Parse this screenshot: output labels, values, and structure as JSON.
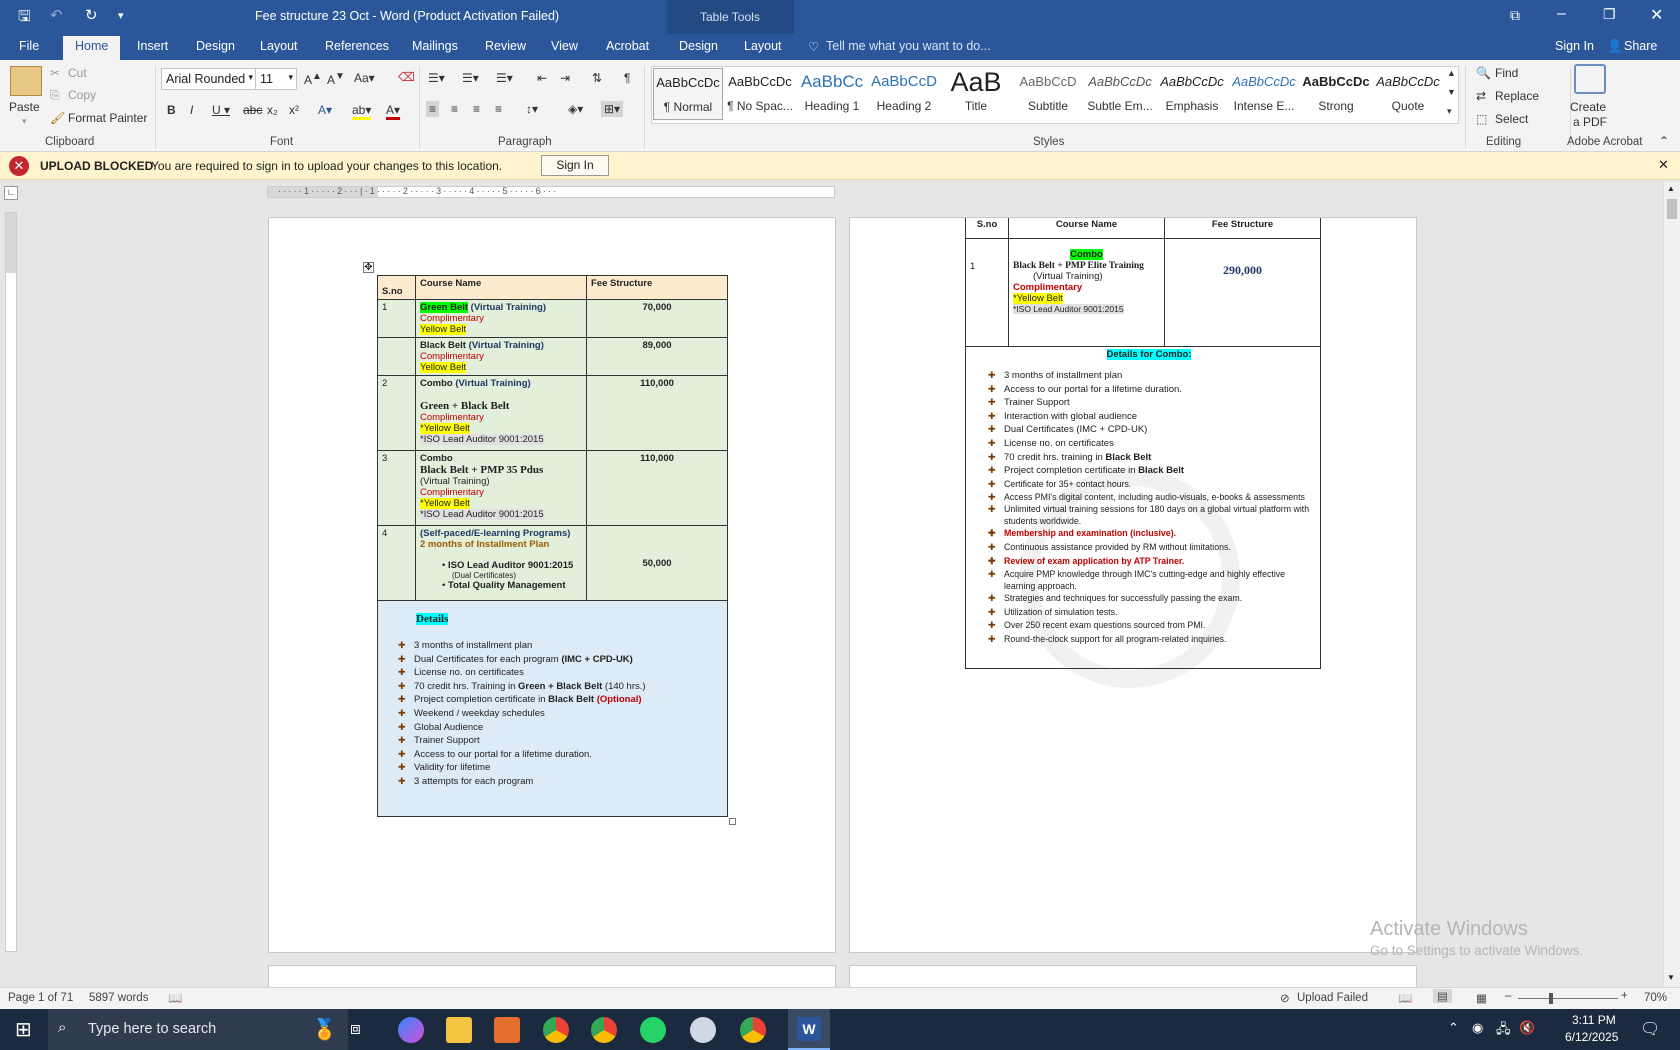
{
  "window": {
    "title": "Fee structure 23 Oct - Word (Product Activation Failed)",
    "context_tab": "Table Tools",
    "tell_me": "Tell me what you want to do...",
    "sign_in": "Sign In",
    "share": "Share"
  },
  "tabs": [
    "File",
    "Home",
    "Insert",
    "Design",
    "Layout",
    "References",
    "Mailings",
    "Review",
    "View",
    "Acrobat",
    "Design",
    "Layout"
  ],
  "ribbon": {
    "clipboard": {
      "paste": "Paste",
      "cut": "Cut",
      "copy": "Copy",
      "format_painter": "Format Painter",
      "label": "Clipboard"
    },
    "font": {
      "name": "Arial Rounded",
      "size": "11",
      "label": "Font"
    },
    "paragraph": {
      "label": "Paragraph"
    },
    "styles": {
      "label": "Styles",
      "items": [
        {
          "preview": "AaBbCcDc",
          "name": "¶ Normal"
        },
        {
          "preview": "AaBbCcDc",
          "name": "¶ No Spac..."
        },
        {
          "preview": "AaBbCc",
          "name": "Heading 1"
        },
        {
          "preview": "AaBbCcD",
          "name": "Heading 2"
        },
        {
          "preview": "AaB",
          "name": "Title"
        },
        {
          "preview": "AaBbCcD",
          "name": "Subtitle"
        },
        {
          "preview": "AaBbCcDc",
          "name": "Subtle Em..."
        },
        {
          "preview": "AaBbCcDc",
          "name": "Emphasis"
        },
        {
          "preview": "AaBbCcDc",
          "name": "Intense E..."
        },
        {
          "preview": "AaBbCcDc",
          "name": "Strong"
        },
        {
          "preview": "AaBbCcDc",
          "name": "Quote"
        }
      ]
    },
    "editing": {
      "find": "Find",
      "replace": "Replace",
      "select": "Select",
      "label": "Editing"
    },
    "acrobat": {
      "create1": "Create",
      "create2": "a PDF",
      "label": "Adobe Acrobat"
    }
  },
  "message": {
    "title": "UPLOAD BLOCKED",
    "text": "You are required to sign in to upload your changes to this location.",
    "button": "Sign In"
  },
  "page1": {
    "headers": {
      "sno": "S.no",
      "course": "Course Name",
      "fee": "Fee Structure"
    },
    "r1": {
      "sno": "1",
      "green": "Green Belt",
      "vt": " (Virtual Training)",
      "comp": "Complimentary",
      "yb": "Yellow Belt",
      "fee": "70,000"
    },
    "r1b": {
      "bb": "Black Belt",
      "vt": " (Virtual Training)",
      "comp": "Complimentary",
      "yb": "Yellow Belt",
      "fee": "89,000"
    },
    "r2": {
      "sno": "2",
      "combo": "Combo",
      "vt": " (Virtual Training)",
      "gb": "Green + Black Belt",
      "comp": "Complimentary",
      "yb": "*Yellow Belt",
      "iso": "*ISO Lead Auditor 9001:2015",
      "fee": "110,000"
    },
    "r3": {
      "sno": "3",
      "combo": "Combo",
      "bp": "Black Belt + PMP 35 Pdus",
      "vt": "(Virtual Training)",
      "comp": "Complimentary",
      "yb": "*Yellow Belt",
      "iso": "*ISO Lead Auditor 9001:2015",
      "fee": "110,000"
    },
    "r4": {
      "sno": "4",
      "sp": "(Self-paced/E-learning Programs)",
      "inst": "2 months of Installment Plan",
      "b1": "ISO Lead Auditor 9001:2015",
      "b1s": "(Dual Certificates)",
      "b2": "Total Quality Management",
      "fee": "50,000"
    },
    "details_title": "Details",
    "details": {
      "d1": "3 months of installment plan",
      "d2a": "Dual Certificates for each program ",
      "d2b": "(IMC + CPD-UK)",
      "d3": "License no. on certificates",
      "d4a": "70 credit hrs. Training in ",
      "d4b": "Green + Black Belt",
      "d4c": " (140 hrs.)",
      "d5a": "Project completion certificate in ",
      "d5b": "Black Belt",
      "d5c": " (Optional)",
      "d6": "Weekend / weekday schedules",
      "d7": "Global Audience",
      "d8": "Trainer Support",
      "d9": "Access to our portal for a lifetime duration.",
      "d10": "Validity for lifetime",
      "d11": "3 attempts for each program"
    }
  },
  "page2": {
    "headers": {
      "sno": "S.no",
      "course": "Course Name",
      "fee": "Fee Structure"
    },
    "row": {
      "sno": "1",
      "combo": "Combo",
      "bp": "Black Belt + PMP Elite Training",
      "vt": "(Virtual Training)",
      "comp": "Complimentary",
      "yb": "*Yellow Belt",
      "iso": "*ISO Lead Auditor 9001:2015",
      "fee": "290,000"
    },
    "details_title": "Details for Combo:",
    "items": {
      "i1": "3 months of installment plan",
      "i2": "Access to our portal for a lifetime duration.",
      "i3": "Trainer Support",
      "i4": "Interaction with global audience",
      "i5": "Dual Certificates (IMC + CPD-UK)",
      "i6": "License no. on certificates",
      "i7a": "70 credit hrs. training in ",
      "i7b": "Black Belt",
      "i8a": "Project completion certificate in ",
      "i8b": "Black Belt",
      "i9": "Certificate for 35+ contact hours.",
      "i10": " Access PMI's digital content, including audio-visuals, e-books & assessments",
      "i11": " Unlimited virtual training sessions for 180 days on a global virtual platform with students worldwide.",
      "i12": " Membership and examination (inclusive).",
      "i13": "Continuous assistance provided by RM without limitations.",
      "i14": " Review of exam application by ATP Trainer.",
      "i15": "Acquire PMP knowledge through IMC's cutting-edge and highly effective learning approach.",
      "i16": "Strategies and techniques for successfully passing the exam.",
      "i17": "Utilization of simulation tests.",
      "i18": "Over 250 recent exam questions sourced from PMI.",
      "i19": " Round-the-clock support for all program-related inquiries."
    }
  },
  "watermark": {
    "l1": "Activate Windows",
    "l2": "Go to Settings to activate Windows."
  },
  "status": {
    "page": "Page 1 of 71",
    "words": "5897 words",
    "upload": "Upload Failed",
    "zoom": "70%"
  },
  "taskbar": {
    "search": "Type here to search",
    "time": "3:11 PM",
    "date": "6/12/2025"
  }
}
